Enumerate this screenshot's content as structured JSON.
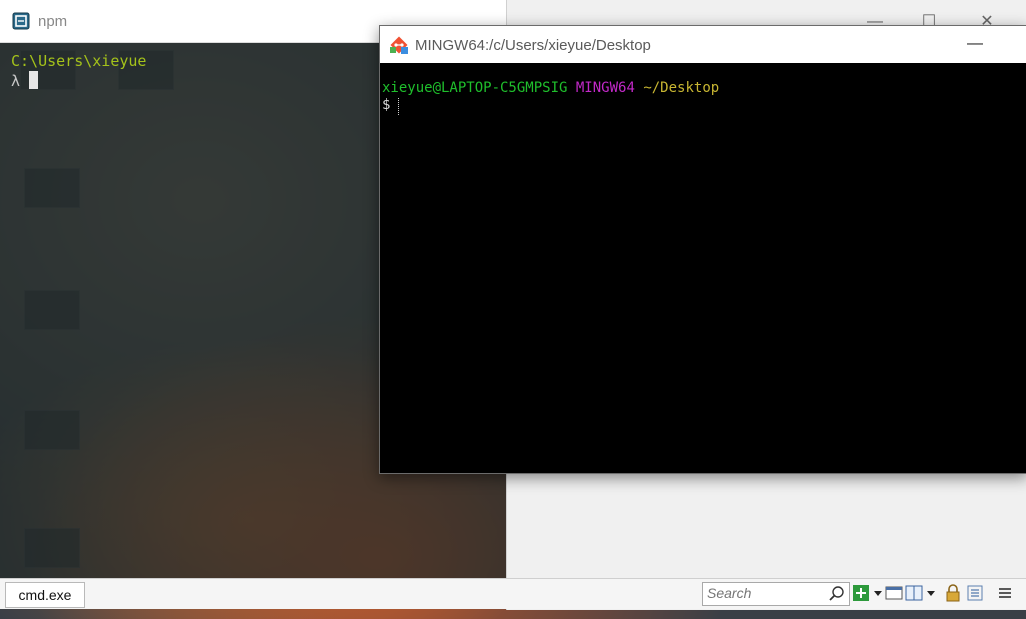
{
  "cmder": {
    "title": "npm",
    "path_line": "C:\\Users\\xieyue",
    "prompt_symbol": "λ",
    "tab_label": "cmd.exe",
    "search_placeholder": "Search"
  },
  "mingw": {
    "title": "MINGW64:/c/Users/xieyue/Desktop",
    "user_host": "xieyue@LAPTOP-C5GMPSIG",
    "system": "MINGW64",
    "cwd": "~/Desktop",
    "prompt": "$",
    "minimize_glyph": "—"
  },
  "third_window": {
    "minimize_glyph": "—",
    "maximize_glyph": "☐",
    "close_glyph": "✕"
  },
  "colors": {
    "cmder_path": "#a4c21a",
    "mingw_user": "#1fbf2c",
    "mingw_system": "#c229c8",
    "mingw_cwd": "#c8b632"
  },
  "icons": [
    "cmder-app-icon",
    "git-app-icon",
    "search-icon",
    "add-tab-icon",
    "console-icon",
    "split-icon",
    "settings-icon",
    "lock-icon",
    "menu-icon"
  ]
}
